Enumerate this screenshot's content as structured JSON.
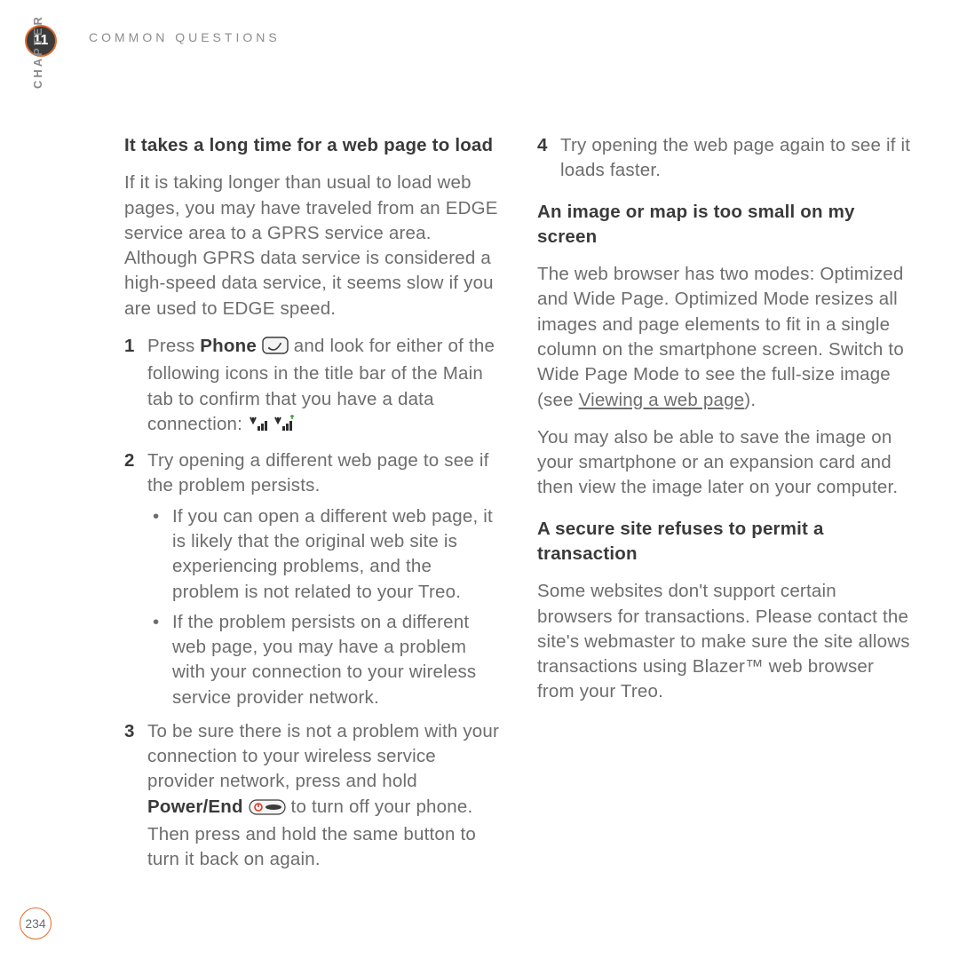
{
  "chapter_number": "11",
  "chapter_label": "CHAPTER",
  "running_head": "COMMON QUESTIONS",
  "page_number": "234",
  "left": {
    "h1": "It takes a long time for a web page to load",
    "p1": "If it is taking longer than usual to load web pages, you may have traveled from an EDGE service area to a GPRS service area. Although GPRS data service is considered a high-speed data service, it seems slow if you are used to EDGE speed.",
    "s1_num": "1",
    "s1_a": "Press ",
    "s1_phone": "Phone",
    "s1_b": " and look for either of the following icons in the title bar of the Main tab to confirm that you have a data connection: ",
    "s2_num": "2",
    "s2": "Try opening a different web page to see if the problem persists.",
    "s2_b1": "If you can open a different web page, it is likely that the original web site is experiencing problems, and the problem is not related to your Treo.",
    "s2_b2": "If the problem persists on a different web page, you may have a problem with your connection to your wireless service provider network.",
    "s3_num": "3",
    "s3_a": "To be sure there is not a problem with your connection to your wireless service provider network, press and hold ",
    "s3_power": "Power/End",
    "s3_b": " to turn off your phone. Then press and hold the same button to turn it back on again."
  },
  "right": {
    "s4_num": "4",
    "s4": "Try opening the web page again to see if it loads faster.",
    "h2": "An image or map is too small on my screen",
    "p2_a": "The web browser has two modes: Optimized and Wide Page. Optimized Mode resizes all images and page elements to fit in a single column on the smartphone screen. Switch to Wide Page Mode to see the full-size image (see ",
    "p2_link": "Viewing a web page",
    "p2_b": ").",
    "p3": "You may also be able to save the image on your smartphone or an expansion card and then view the image later on your computer.",
    "h3": "A secure site refuses to permit a transaction",
    "p4": "Some websites don't support certain browsers for transactions. Please contact the site's webmaster to make sure the site allows transactions using Blazer™ web browser from your Treo."
  }
}
